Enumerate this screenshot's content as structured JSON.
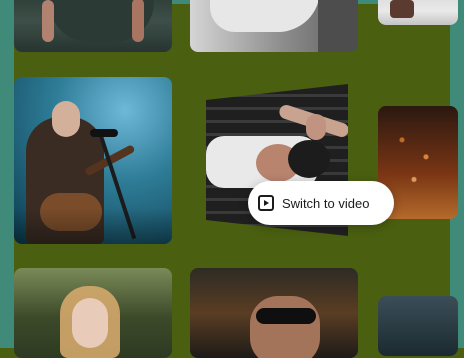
{
  "cta": {
    "label": "Switch to video",
    "icon": "video-icon"
  },
  "colors": {
    "background": "#4a5f10",
    "frame": "#3f8a78",
    "button_bg": "#ffffff",
    "button_text": "#1c1c1c"
  }
}
